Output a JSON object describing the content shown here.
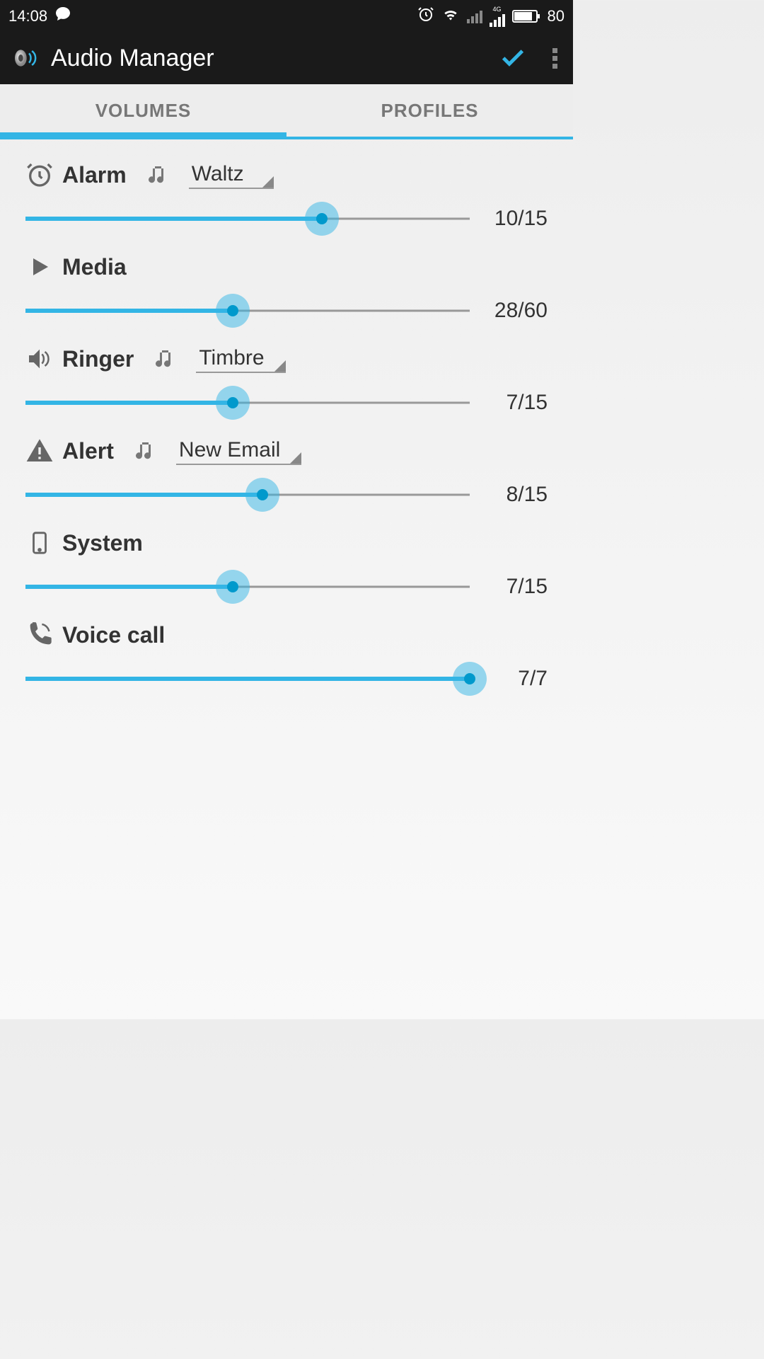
{
  "status": {
    "time": "14:08",
    "battery": "80",
    "battery_pct": 80,
    "network": "4G"
  },
  "app": {
    "title": "Audio Manager"
  },
  "tabs": {
    "volumes": "VOLUMES",
    "profiles": "PROFILES",
    "active": "volumes"
  },
  "channels": [
    {
      "id": "alarm",
      "icon": "alarm-clock-icon",
      "label": "Alarm",
      "tone": "Waltz",
      "value": 10,
      "max": 15
    },
    {
      "id": "media",
      "icon": "play-icon",
      "label": "Media",
      "tone": null,
      "value": 28,
      "max": 60
    },
    {
      "id": "ringer",
      "icon": "speaker-icon",
      "label": "Ringer",
      "tone": "Timbre",
      "value": 7,
      "max": 15
    },
    {
      "id": "alert",
      "icon": "warning-icon",
      "label": "Alert",
      "tone": "New Email",
      "value": 8,
      "max": 15
    },
    {
      "id": "system",
      "icon": "phone-device-icon",
      "label": "System",
      "tone": null,
      "value": 7,
      "max": 15
    },
    {
      "id": "voicecall",
      "icon": "phone-call-icon",
      "label": "Voice call",
      "tone": null,
      "value": 7,
      "max": 7
    }
  ]
}
